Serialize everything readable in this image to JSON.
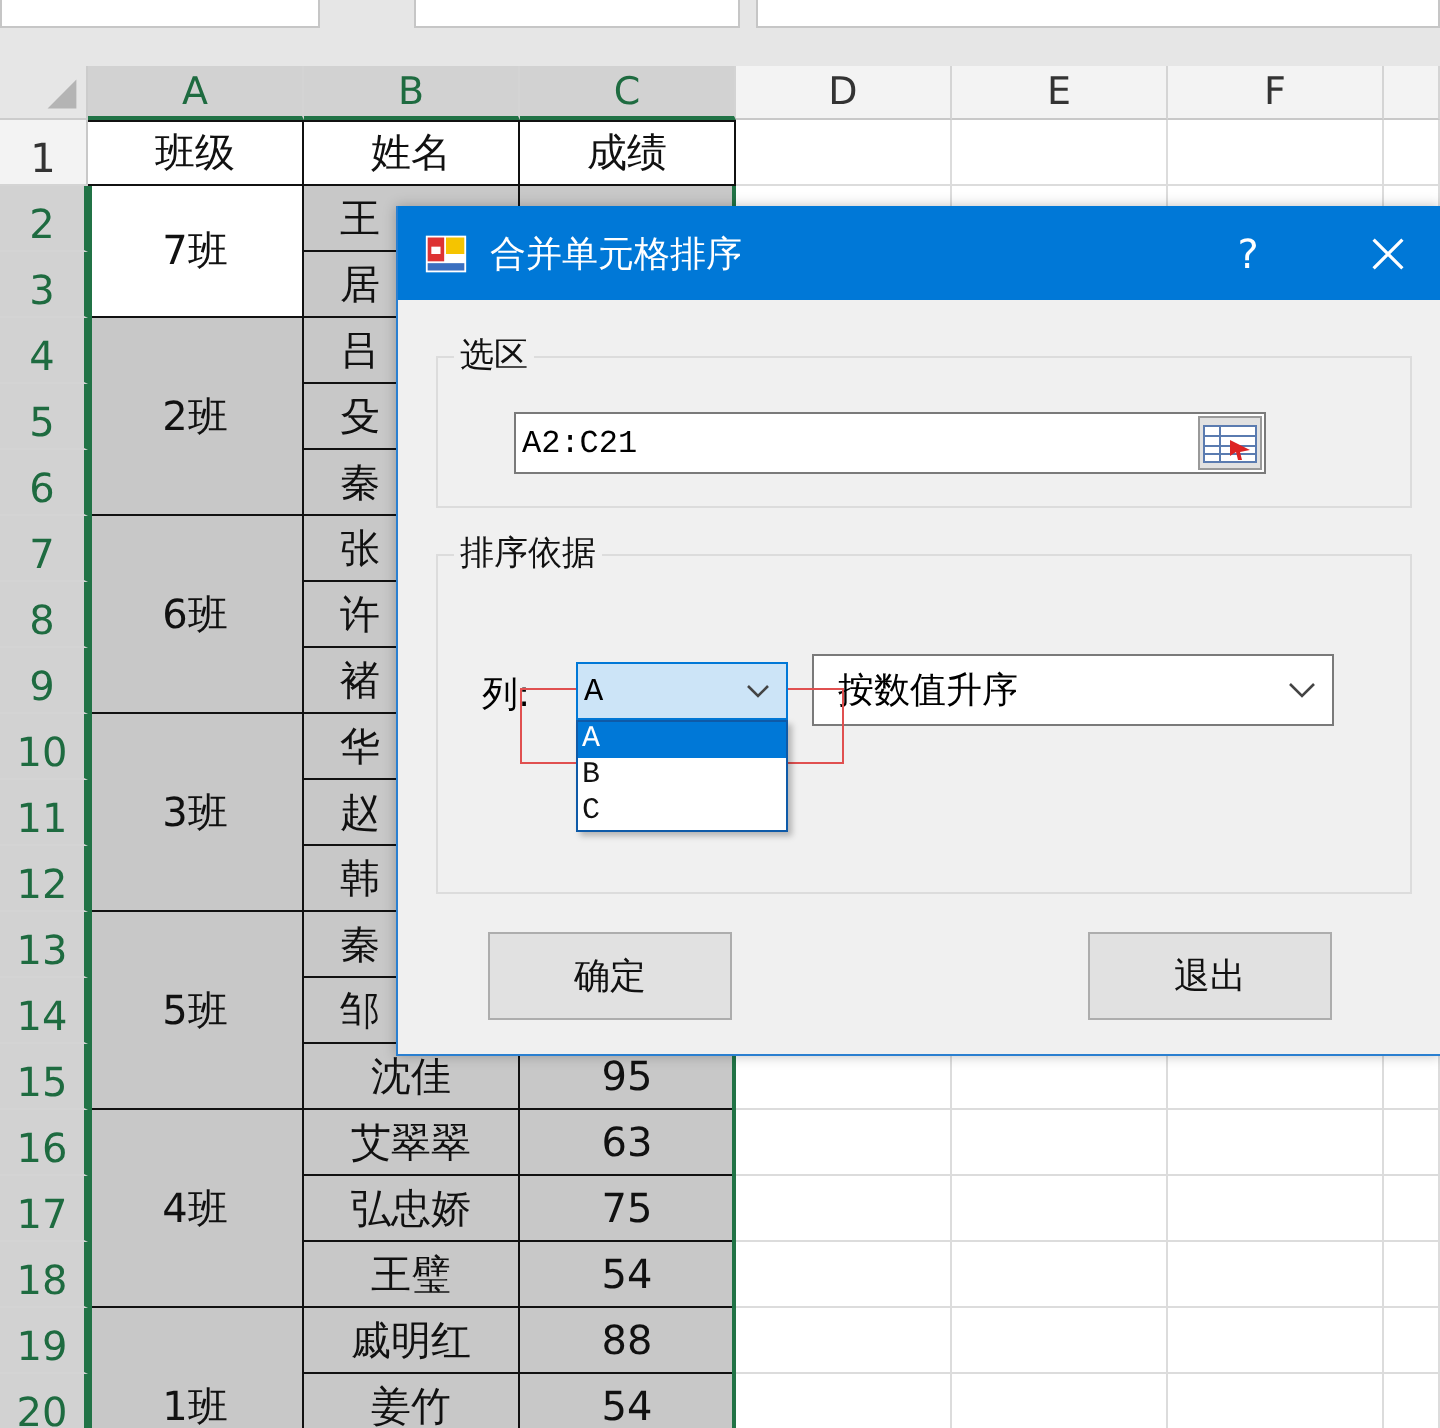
{
  "columns": [
    {
      "label": "A",
      "highlighted": true
    },
    {
      "label": "B",
      "highlighted": true
    },
    {
      "label": "C",
      "highlighted": true
    },
    {
      "label": "D",
      "highlighted": false
    },
    {
      "label": "E",
      "highlighted": false
    },
    {
      "label": "F",
      "highlighted": false
    }
  ],
  "row_numbers": [
    {
      "label": "1",
      "highlighted": false
    },
    {
      "label": "2",
      "highlighted": true
    },
    {
      "label": "3",
      "highlighted": true
    },
    {
      "label": "4",
      "highlighted": true
    },
    {
      "label": "5",
      "highlighted": true
    },
    {
      "label": "6",
      "highlighted": true
    },
    {
      "label": "7",
      "highlighted": true
    },
    {
      "label": "8",
      "highlighted": true
    },
    {
      "label": "9",
      "highlighted": true
    },
    {
      "label": "10",
      "highlighted": true
    },
    {
      "label": "11",
      "highlighted": true
    },
    {
      "label": "12",
      "highlighted": true
    },
    {
      "label": "13",
      "highlighted": true
    },
    {
      "label": "14",
      "highlighted": true
    },
    {
      "label": "15",
      "highlighted": true
    },
    {
      "label": "16",
      "highlighted": true
    },
    {
      "label": "17",
      "highlighted": true
    },
    {
      "label": "18",
      "highlighted": true
    },
    {
      "label": "19",
      "highlighted": true
    },
    {
      "label": "20",
      "highlighted": true
    }
  ],
  "header_row": [
    "班级",
    "姓名",
    "成绩"
  ],
  "groups": [
    {
      "class": "7班",
      "active": true,
      "rows": [
        {
          "name": "王",
          "cut": true
        },
        {
          "name": "居",
          "cut": true
        }
      ]
    },
    {
      "class": "2班",
      "active": false,
      "rows": [
        {
          "name": "吕",
          "cut": true
        },
        {
          "name": "殳",
          "cut": true
        },
        {
          "name": "秦",
          "cut": true
        }
      ]
    },
    {
      "class": "6班",
      "active": false,
      "rows": [
        {
          "name": "张",
          "cut": true
        },
        {
          "name": "许",
          "cut": true
        },
        {
          "name": "褚",
          "cut": true
        }
      ]
    },
    {
      "class": "3班",
      "active": false,
      "rows": [
        {
          "name": "华",
          "cut": true
        },
        {
          "name": "赵",
          "cut": true
        },
        {
          "name": "韩",
          "cut": true
        }
      ]
    },
    {
      "class": "5班",
      "active": false,
      "rows": [
        {
          "name": "秦",
          "cut": true
        },
        {
          "name": "邹",
          "cut": true
        },
        {
          "name": "沈佳",
          "cut": false,
          "score": "95"
        }
      ]
    },
    {
      "class": "4班",
      "active": false,
      "rows": [
        {
          "name": "艾翠翠",
          "cut": false,
          "score": "63"
        },
        {
          "name": "弘忠娇",
          "cut": false,
          "score": "75"
        },
        {
          "name": "王璧",
          "cut": false,
          "score": "54"
        }
      ]
    },
    {
      "class": "1班",
      "active": false,
      "rows": [
        {
          "name": "戚明红",
          "cut": false,
          "score": "88"
        },
        {
          "name": "姜竹",
          "cut": false,
          "score": "54"
        }
      ]
    }
  ],
  "dialog": {
    "title": "合并单元格排序",
    "help": "?",
    "selection_group": {
      "legend": "选区",
      "range": "A2:C21"
    },
    "sort_group": {
      "legend": "排序依据",
      "column_label": "列:",
      "column_value": "A",
      "expanded": true,
      "column_options": [
        {
          "label": "A",
          "selected": true
        },
        {
          "label": "B",
          "selected": false
        },
        {
          "label": "C",
          "selected": false
        }
      ],
      "order_value": "按数值升序"
    },
    "buttons": [
      "确定",
      "退出"
    ]
  }
}
